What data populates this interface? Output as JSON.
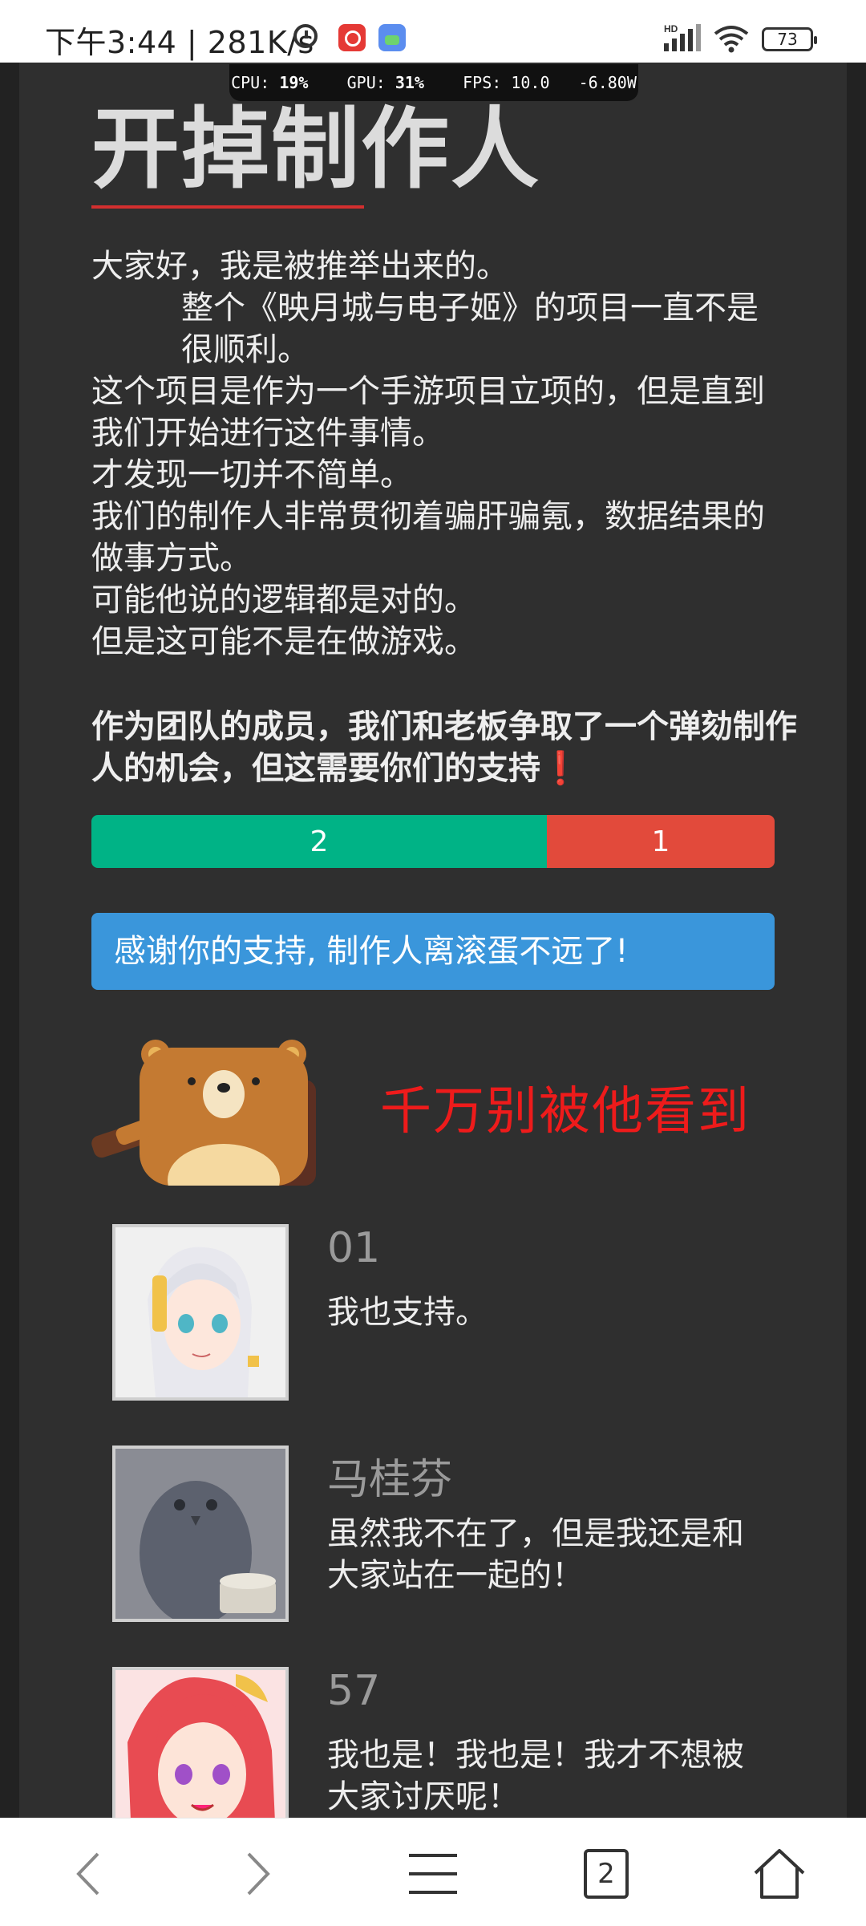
{
  "status_bar": {
    "time_speed": "下午3:44 | 281K/s",
    "battery": "73",
    "icons": [
      "alarm-icon",
      "app-icon",
      "gallery-icon",
      "signal-icon",
      "wifi-icon",
      "battery-icon"
    ]
  },
  "perf_overlay": {
    "cpu_label": "CPU:",
    "cpu_value": "19%",
    "gpu_label": "GPU:",
    "gpu_value": "31%",
    "fps_label": "FPS:",
    "fps_value": "10.0",
    "power": "-6.80W"
  },
  "article": {
    "title": "开掉制作人",
    "paragraphs": [
      "大家好，我是被推举出来的。",
      "整个《映月城与电子姬》的项目一直不是很顺利。",
      "这个项目是作为一个手游项目立项的，但是直到我们开始进行这件事情。",
      "才发现一切并不简单。",
      "我们的制作人非常贯彻着骗肝骗氪，数据结果的做事方式。",
      "可能他说的逻辑都是对的。",
      "但是这可能不是在做游戏。"
    ],
    "call_to_action": "作为团队的成员，我们和老板争取了一个弹劾制作人的机会，但这需要你们的支持",
    "call_to_action_mark": "❗"
  },
  "vote": {
    "yes_count": "2",
    "no_count": "1",
    "yes_fraction": 0.6667,
    "yes_color": "#00b386",
    "no_color": "#e24a3b"
  },
  "thanks_button": {
    "label": "感谢你的支持, 制作人离滚蛋不远了!",
    "color": "#3a96db"
  },
  "warning_text": "千万别被他看到",
  "comments": [
    {
      "name": "01",
      "text": "我也支持。",
      "avatar": "white-hair-girl-avatar"
    },
    {
      "name": "马桂芬",
      "text": "虽然我不在了，但是我还是和大家站在一起的！",
      "avatar": "owl-avatar"
    },
    {
      "name": "57",
      "text": "我也是！我也是！我才不想被大家讨厌呢！",
      "avatar": "red-hair-girl-avatar"
    }
  ],
  "nav": {
    "tab_count": "2",
    "icons": [
      "back-icon",
      "forward-icon",
      "menu-icon",
      "tabs-icon",
      "home-icon"
    ]
  }
}
